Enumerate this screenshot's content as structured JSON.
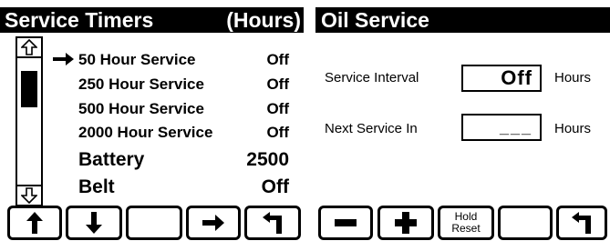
{
  "left_screen": {
    "title": "Service Timers",
    "title_unit": "(Hours)",
    "items": [
      {
        "label": "50 Hour Service",
        "value": "Off",
        "selected": true
      },
      {
        "label": "250 Hour Service",
        "value": "Off"
      },
      {
        "label": "500 Hour Service",
        "value": "Off"
      },
      {
        "label": "2000 Hour Service",
        "value": "Off"
      },
      {
        "label": "Battery",
        "value": "2500"
      },
      {
        "label": "Belt",
        "value": "Off"
      }
    ],
    "function_keys": [
      {
        "icon": "up-arrow-icon"
      },
      {
        "icon": "down-arrow-icon"
      },
      {
        "icon": ""
      },
      {
        "icon": "right-arrow-icon"
      },
      {
        "icon": "back-return-icon"
      }
    ]
  },
  "right_screen": {
    "title": "Oil Service",
    "service_interval_label": "Service Interval",
    "service_interval_value": "Off",
    "service_interval_unit": "Hours",
    "next_service_label": "Next Service In",
    "next_service_value": "___",
    "next_service_unit": "Hours",
    "function_keys": [
      {
        "icon": "minus-icon"
      },
      {
        "icon": "plus-icon"
      },
      {
        "label": "Hold\nReset"
      },
      {
        "icon": ""
      },
      {
        "icon": "back-return-icon"
      }
    ]
  }
}
